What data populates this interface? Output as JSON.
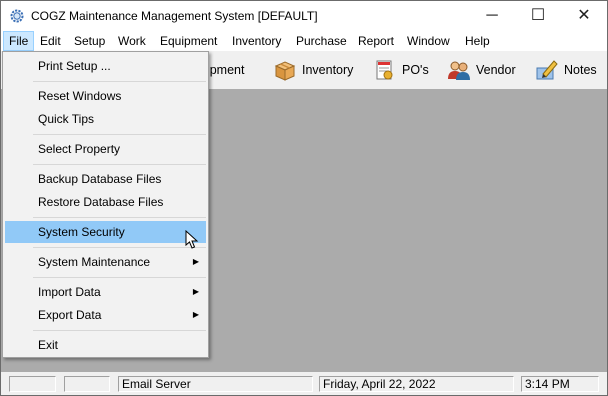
{
  "window": {
    "title": "COGZ Maintenance Management System [DEFAULT]",
    "controls": [
      "─",
      "☐",
      "✕"
    ]
  },
  "menubar": {
    "items": [
      "File",
      "Edit",
      "Setup",
      "Work",
      "Equipment",
      "Inventory",
      "Purchase",
      "Report",
      "Window",
      "Help"
    ]
  },
  "toolbar": {
    "buttons": [
      {
        "label": "uipment",
        "icon": "equipment-icon"
      },
      {
        "label": "Inventory",
        "icon": "inventory-box-icon"
      },
      {
        "label": "PO's",
        "icon": "purchase-order-icon"
      },
      {
        "label": "Vendor",
        "icon": "vendor-people-icon"
      },
      {
        "label": "Notes",
        "icon": "notes-pencil-icon"
      }
    ]
  },
  "file_menu": {
    "items": [
      {
        "label": "Print Setup ..."
      },
      {
        "label": "Reset Windows"
      },
      {
        "label": "Quick Tips"
      },
      {
        "label": "Select Property"
      },
      {
        "label": "Backup Database Files"
      },
      {
        "label": "Restore Database Files"
      },
      {
        "label": "System Security",
        "highlighted": true
      },
      {
        "label": "System Maintenance",
        "submenu": true
      },
      {
        "label": "Import Data",
        "submenu": true
      },
      {
        "label": "Export Data",
        "submenu": true
      },
      {
        "label": "Exit"
      }
    ],
    "submenu_arrow": "▶"
  },
  "statusbar": {
    "panels": [
      "",
      "",
      "Email Server",
      "Friday, April 22, 2022",
      "3:14 PM"
    ]
  },
  "colors": {
    "client_bg": "#ababab",
    "menu_highlight": "#91c9f7",
    "active_menu": "#cce8ff"
  }
}
